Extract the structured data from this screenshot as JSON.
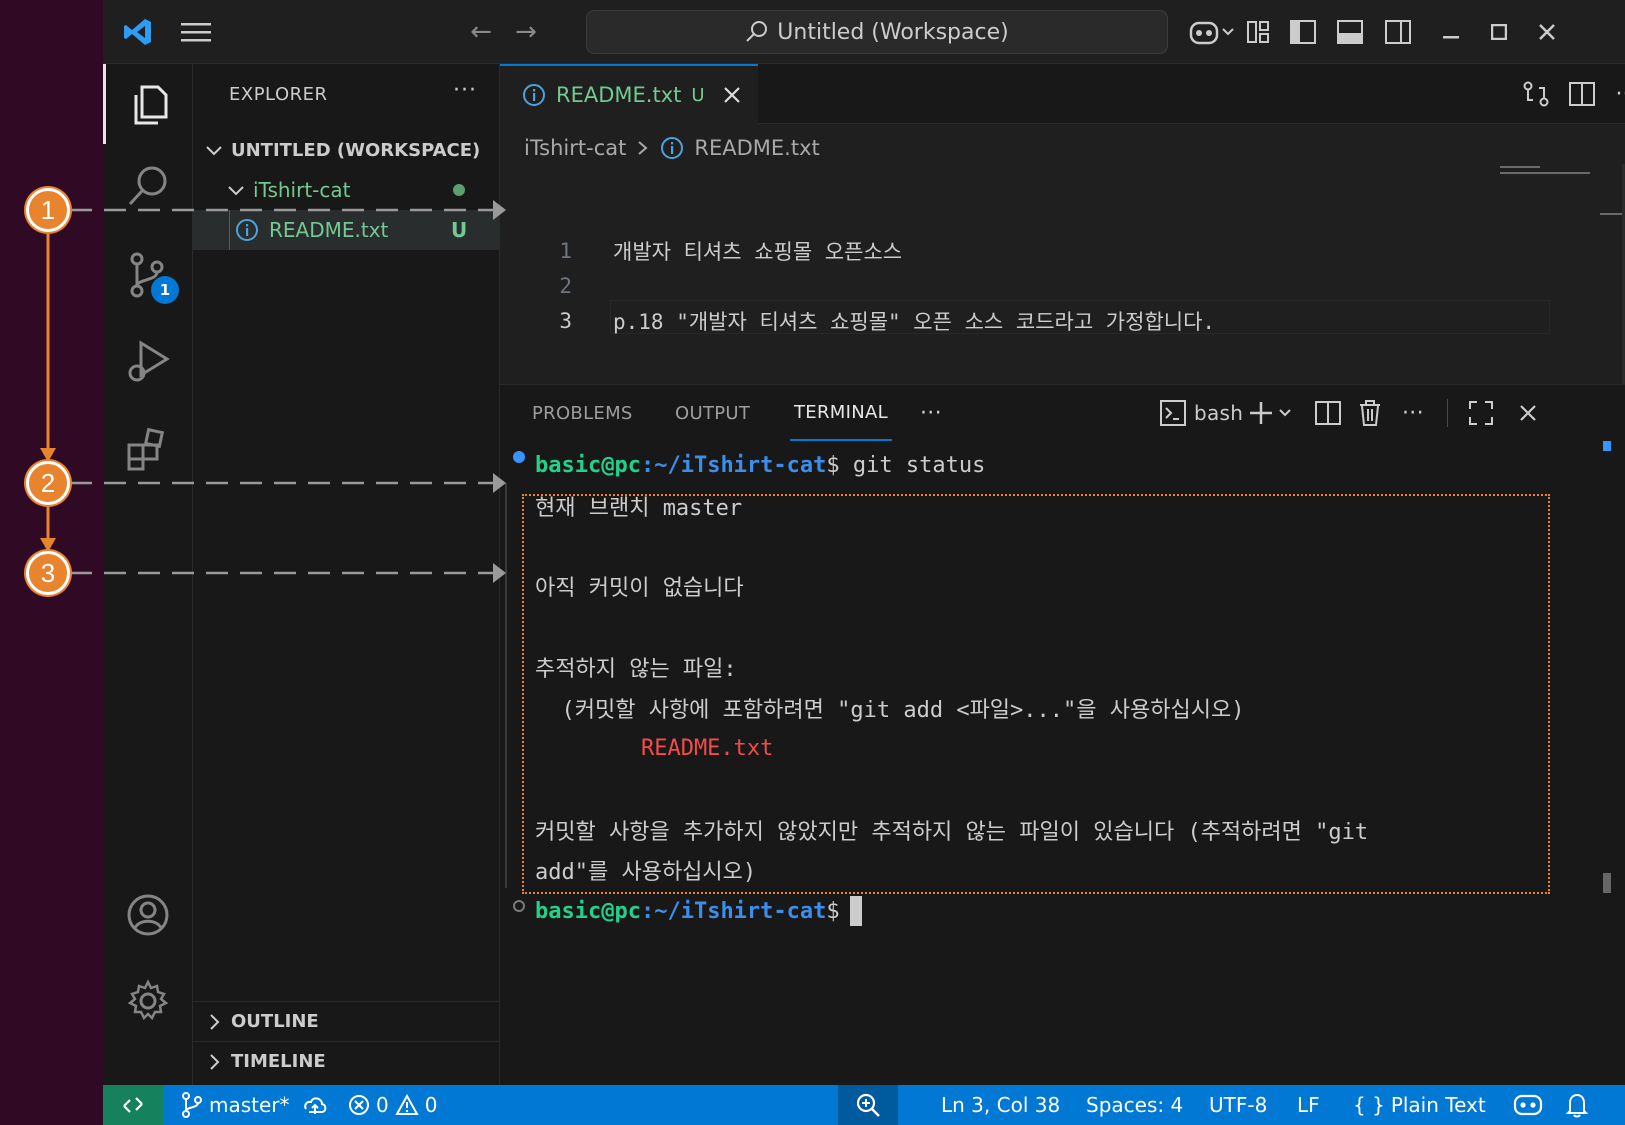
{
  "titlebar": {
    "search_text": "Untitled (Workspace)"
  },
  "activity": {
    "scm_badge": "1"
  },
  "sidebar": {
    "header": "EXPLORER",
    "more": "···",
    "workspace": "UNTITLED (WORKSPACE)",
    "folder": "iTshirt-cat",
    "file": "README.txt",
    "file_status": "U",
    "outline": "OUTLINE",
    "timeline": "TIMELINE"
  },
  "editor": {
    "tab_label": "README.txt",
    "tab_status": "U",
    "breadcrumb_folder": "iTshirt-cat",
    "breadcrumb_file": "README.txt",
    "lines": [
      {
        "num": "1",
        "text": "개발자 티셔츠 쇼핑몰 오픈소스"
      },
      {
        "num": "2",
        "text": ""
      },
      {
        "num": "3",
        "text": "p.18 \"개발자 티셔츠 쇼핑몰\" 오픈 소스 코드라고 가정합니다."
      }
    ]
  },
  "panel": {
    "tabs": [
      "PROBLEMS",
      "OUTPUT",
      "TERMINAL"
    ],
    "active_tab": "TERMINAL",
    "shell": "bash",
    "prompt_user": "basic@pc",
    "prompt_path": ":~/iTshirt-cat",
    "prompt_dollar": "$",
    "command": " git status",
    "output": {
      "branch": "현재 브랜치 master",
      "no_commits": "아직 커밋이 없습니다",
      "untracked_header": "추적하지 않는 파일:",
      "hint": "  (커밋할 사항에 포함하려면 \"git add <파일>...\"을 사용하십시오)",
      "untracked_file": "        README.txt",
      "summary_1": "커밋할 사항을 추가하지 않았지만 추적하지 않는 파일이 있습니다 (추적하려면 \"git",
      "summary_2": "add\"를 사용하십시오)"
    }
  },
  "status": {
    "branch": "master*",
    "errors": "0",
    "warnings": "0",
    "position": "Ln 3, Col 38",
    "spaces": "Spaces: 4",
    "encoding": "UTF-8",
    "eol": "LF",
    "language": "Plain Text"
  },
  "annotations": [
    "1",
    "2",
    "3"
  ],
  "colors": {
    "accent": "#0078d4",
    "annotation": "#e8832e",
    "untracked": "#73c991"
  }
}
